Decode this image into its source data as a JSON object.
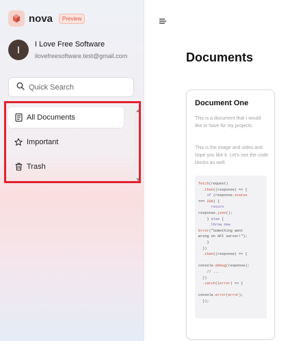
{
  "brand": {
    "name": "nova",
    "badge": "Preview"
  },
  "user": {
    "initial": "I",
    "name": "I Love Free Software",
    "email": "ilovefreesoftware.test@gmail.com"
  },
  "search": {
    "placeholder": "Quick Search"
  },
  "nav": {
    "items": [
      {
        "label": "All Documents",
        "icon": "document-icon",
        "active": true
      },
      {
        "label": "Important",
        "icon": "star-icon",
        "active": false
      },
      {
        "label": "Trash",
        "icon": "trash-icon",
        "active": false
      }
    ]
  },
  "highlight_color": "#e3202d",
  "main": {
    "title": "Documents"
  },
  "document": {
    "title": "Document One",
    "paragraph1": "This is a document that I would like to have for my projects.",
    "paragraph2": "This is the image and video and hope you like it. Let's see the code blocks as well.",
    "code_lines": [
      "fetch(request)",
      "  .then((response) => {",
      "    if (response.status",
      "=== 200) {",
      "      return",
      "response.json();",
      "    } else {",
      "      throw new",
      "Error(\"Something went",
      "wrong on API server!\");",
      "    }",
      "  })",
      "  .then((response) => {",
      "",
      "console.debug(response);",
      "    // ...",
      "  })",
      "  .catch((error) => {",
      "",
      "console.error(error);",
      "  });"
    ]
  }
}
